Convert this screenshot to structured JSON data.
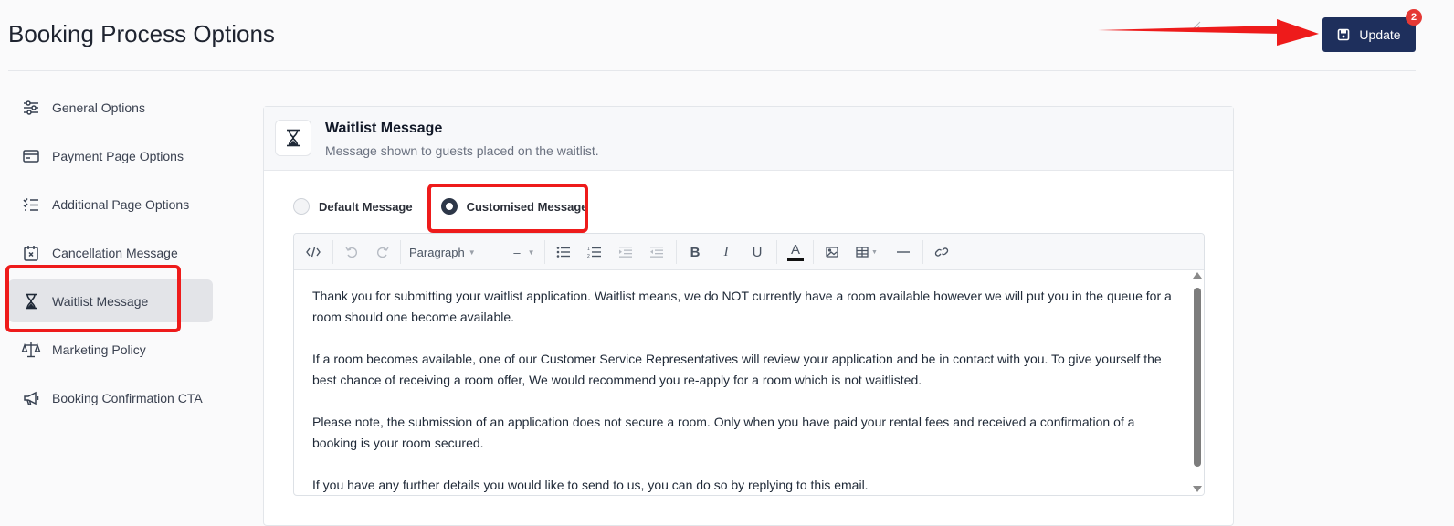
{
  "page": {
    "title": "Booking Process Options"
  },
  "header": {
    "update_label": "Update",
    "update_badge": "2",
    "accent_color": "#1e2f5c",
    "badge_color": "#e53935",
    "annotation_color": "#ee1b1b"
  },
  "sidebar": {
    "items": [
      {
        "label": "General Options",
        "icon": "sliders-icon"
      },
      {
        "label": "Payment Page Options",
        "icon": "credit-card-icon"
      },
      {
        "label": "Additional Page Options",
        "icon": "checklist-icon"
      },
      {
        "label": "Cancellation Message",
        "icon": "calendar-x-icon"
      },
      {
        "label": "Waitlist Message",
        "icon": "hourglass-icon",
        "active": true
      },
      {
        "label": "Marketing Policy",
        "icon": "scales-icon"
      },
      {
        "label": "Booking Confirmation CTA",
        "icon": "megaphone-icon"
      }
    ]
  },
  "card": {
    "title": "Waitlist Message",
    "subtitle": "Message shown to guests placed on the waitlist.",
    "icon": "hourglass-icon"
  },
  "message_type": {
    "options": [
      "Default Message",
      "Customised Message"
    ],
    "selected": "Customised Message"
  },
  "editor": {
    "toolbar": {
      "block_format": "Paragraph",
      "font_size": "–",
      "buttons": [
        "code-view",
        "undo",
        "redo",
        "bullet-list",
        "numbered-list",
        "indent",
        "outdent",
        "bold",
        "italic",
        "underline",
        "text-color",
        "image",
        "table",
        "horizontal-rule",
        "link"
      ]
    },
    "paragraphs": [
      "Thank you for submitting your waitlist application. Waitlist means, we do NOT currently have a room available however we will put you in the queue for a room should one become available.",
      "If a room becomes available, one of our Customer Service Representatives will review your application and be in contact with you. To give yourself the best chance of receiving a room offer, We would recommend you re-apply for a room which is not waitlisted.",
      "Please note, the submission of an application does not secure a room. Only when you have paid your rental fees and received a confirmation of a booking is your room secured.",
      "If you have any further details you would like to send to us, you can do so by replying to this email."
    ]
  }
}
